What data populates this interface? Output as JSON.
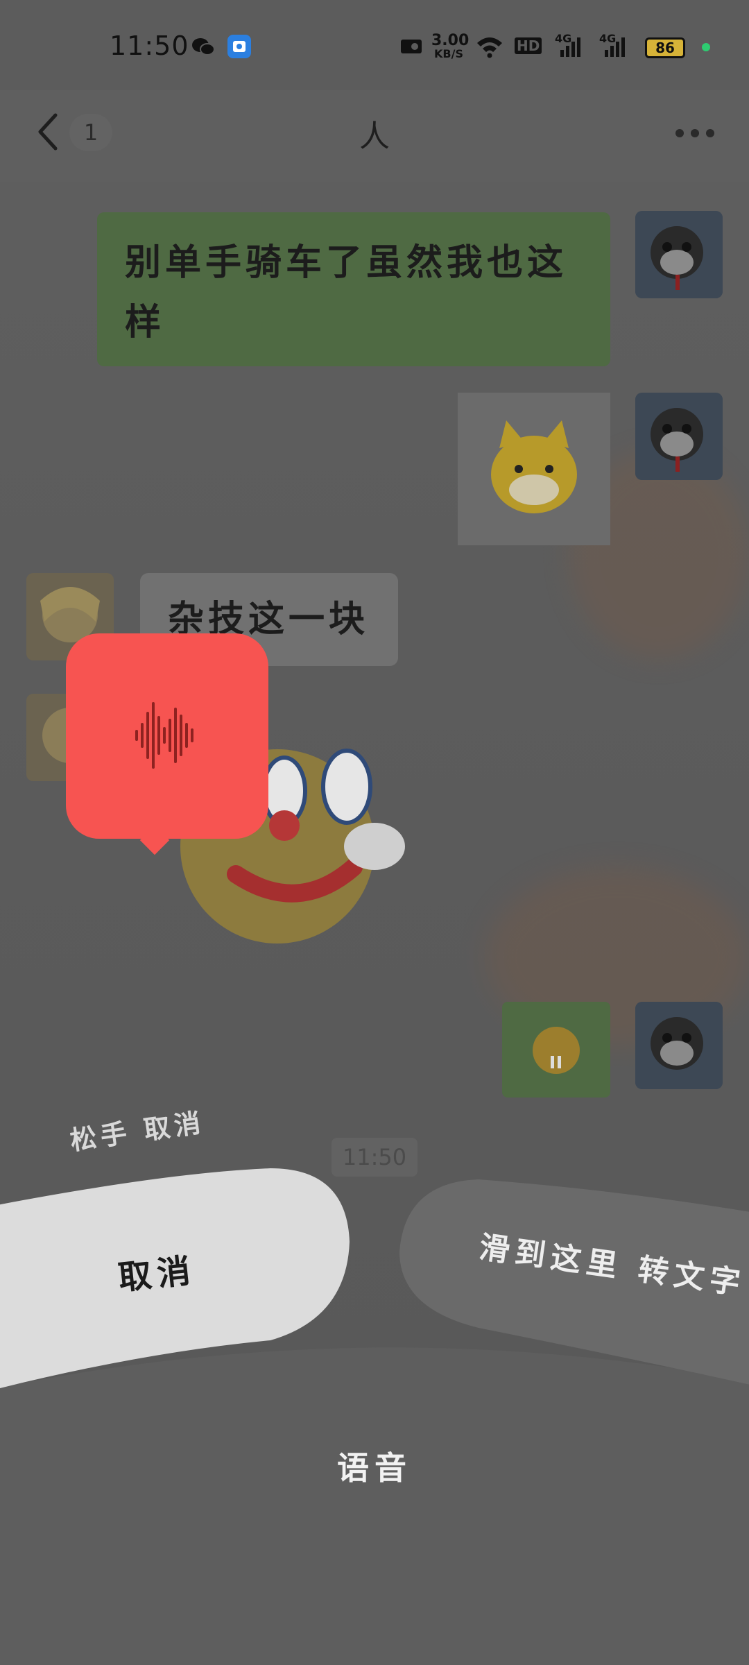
{
  "status_bar": {
    "time": "11:50",
    "speed_value": "3.00",
    "speed_unit": "KB/S",
    "network_1": "4G",
    "network_2": "4G",
    "hd_label": "HD",
    "battery_level": "86"
  },
  "header": {
    "back_icon": "chevron-left-icon",
    "unread_count": "1",
    "title": "人",
    "more_icon": "more-dots-icon"
  },
  "messages": [
    {
      "side": "right",
      "type": "text",
      "text": "别单手骑车了虽然我也这样"
    },
    {
      "side": "right",
      "type": "sticker",
      "sticker": "yellow-dog-sticker"
    },
    {
      "side": "left",
      "type": "text",
      "text": "杂技这一块"
    },
    {
      "side": "left",
      "type": "sticker",
      "sticker": "clown-emoji-sticker"
    },
    {
      "side": "right",
      "type": "sticker",
      "sticker": "small-face-sticker"
    }
  ],
  "timestamp": "11:50",
  "recording": {
    "icon": "sound-wave-icon",
    "hint": "松手 取消"
  },
  "actions": {
    "cancel": "取消",
    "to_text": "滑到这里 转文字",
    "voice": "语音"
  },
  "colors": {
    "record_popup": "#f75451",
    "cancel_area": "#dcdcdc",
    "text_area": "#6a6a6a"
  }
}
